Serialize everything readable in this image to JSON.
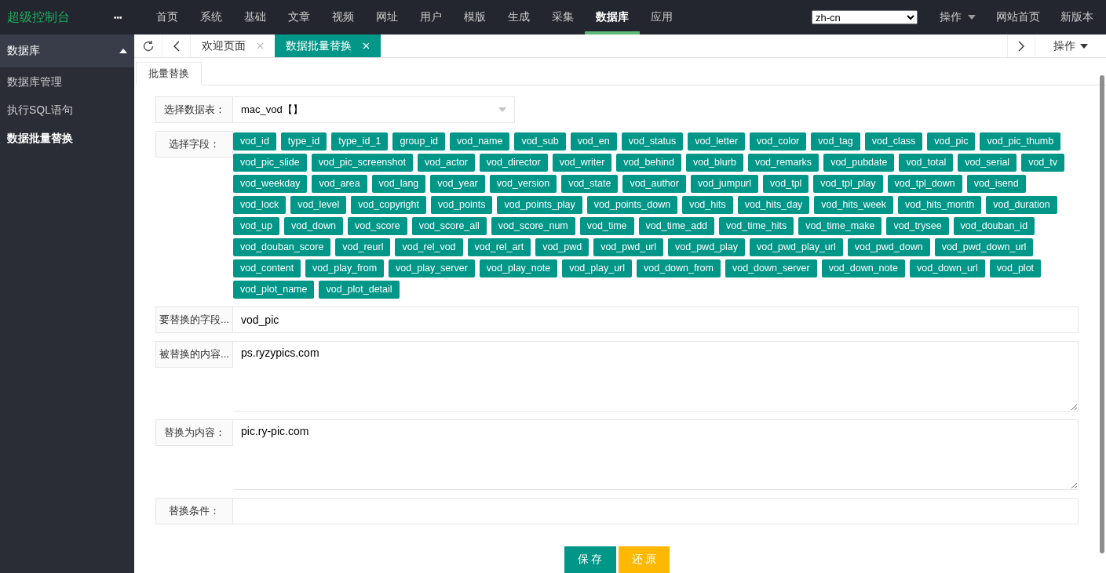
{
  "brand": "超级控制台",
  "more": "•••",
  "nav": [
    {
      "label": "首页",
      "selected": false
    },
    {
      "label": "系统",
      "selected": false
    },
    {
      "label": "基础",
      "selected": false
    },
    {
      "label": "文章",
      "selected": false
    },
    {
      "label": "视频",
      "selected": false
    },
    {
      "label": "网址",
      "selected": false
    },
    {
      "label": "用户",
      "selected": false
    },
    {
      "label": "模版",
      "selected": false
    },
    {
      "label": "生成",
      "selected": false
    },
    {
      "label": "采集",
      "selected": false
    },
    {
      "label": "数据库",
      "selected": true
    },
    {
      "label": "应用",
      "selected": false
    }
  ],
  "language": "zh-cn",
  "top_links": [
    {
      "label": "操作",
      "kind": "menu"
    },
    {
      "label": "网站首页",
      "kind": "link"
    },
    {
      "label": "新版本",
      "kind": "link"
    }
  ],
  "sidebar": {
    "title": "数据库",
    "expanded": true,
    "items": [
      {
        "label": "数据库管理",
        "selected": false
      },
      {
        "label": "执行SQL语句",
        "selected": false
      },
      {
        "label": "数据批量替换",
        "selected": true
      }
    ]
  },
  "page_tabs": [
    {
      "label": "欢迎页面",
      "selected": false
    },
    {
      "label": "数据批量替换",
      "selected": true
    }
  ],
  "tab_actions": "操作",
  "subtabs": [
    {
      "label": "批量替换",
      "selected": true
    }
  ],
  "form": {
    "table_label": "选择数据表：",
    "table_value": "mac_vod【】",
    "fields_label": "选择字段：",
    "fields": [
      "vod_id",
      "type_id",
      "type_id_1",
      "group_id",
      "vod_name",
      "vod_sub",
      "vod_en",
      "vod_status",
      "vod_letter",
      "vod_color",
      "vod_tag",
      "vod_class",
      "vod_pic",
      "vod_pic_thumb",
      "vod_pic_slide",
      "vod_pic_screenshot",
      "vod_actor",
      "vod_director",
      "vod_writer",
      "vod_behind",
      "vod_blurb",
      "vod_remarks",
      "vod_pubdate",
      "vod_total",
      "vod_serial",
      "vod_tv",
      "vod_weekday",
      "vod_area",
      "vod_lang",
      "vod_year",
      "vod_version",
      "vod_state",
      "vod_author",
      "vod_jumpurl",
      "vod_tpl",
      "vod_tpl_play",
      "vod_tpl_down",
      "vod_isend",
      "vod_lock",
      "vod_level",
      "vod_copyright",
      "vod_points",
      "vod_points_play",
      "vod_points_down",
      "vod_hits",
      "vod_hits_day",
      "vod_hits_week",
      "vod_hits_month",
      "vod_duration",
      "vod_up",
      "vod_down",
      "vod_score",
      "vod_score_all",
      "vod_score_num",
      "vod_time",
      "vod_time_add",
      "vod_time_hits",
      "vod_time_make",
      "vod_trysee",
      "vod_douban_id",
      "vod_douban_score",
      "vod_reurl",
      "vod_rel_vod",
      "vod_rel_art",
      "vod_pwd",
      "vod_pwd_url",
      "vod_pwd_play",
      "vod_pwd_play_url",
      "vod_pwd_down",
      "vod_pwd_down_url",
      "vod_content",
      "vod_play_from",
      "vod_play_server",
      "vod_play_note",
      "vod_play_url",
      "vod_down_from",
      "vod_down_server",
      "vod_down_note",
      "vod_down_url",
      "vod_plot",
      "vod_plot_name",
      "vod_plot_detail"
    ],
    "inputs": [
      {
        "label": "要替换的字段...",
        "kind": "input",
        "value": "vod_pic"
      },
      {
        "label": "被替换的内容...",
        "kind": "textarea",
        "value": "ps.ryzypics.com"
      },
      {
        "label": "替换为内容：",
        "kind": "textarea",
        "value": "pic.ry-pic.com"
      },
      {
        "label": "替换条件：",
        "kind": "input"
      }
    ]
  },
  "buttons": [
    {
      "label": "保 存",
      "kind": "primary"
    },
    {
      "label": "还 原",
      "kind": "warm"
    }
  ]
}
